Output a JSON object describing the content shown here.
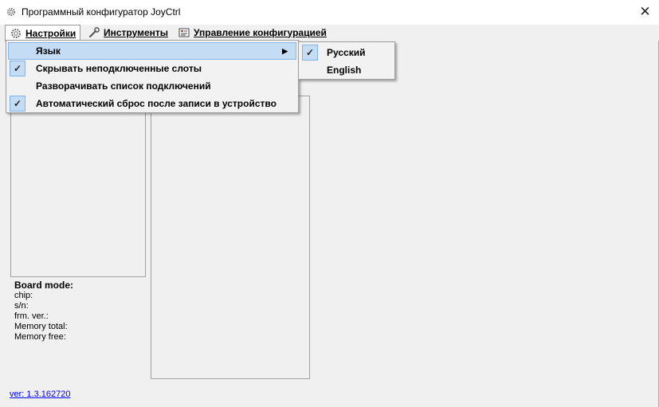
{
  "window": {
    "title": "Программный конфигуратор JoyCtrl",
    "close_glyph": "✕"
  },
  "menubar": {
    "items": [
      {
        "label": "Настройки",
        "icon": "gear-icon"
      },
      {
        "label": "Инструменты",
        "icon": "wrench-icon"
      },
      {
        "label": "Управление конфигурацией",
        "icon": "config-icon"
      }
    ]
  },
  "settings_menu": {
    "items": [
      {
        "label": "Язык",
        "checked": false,
        "has_submenu": true
      },
      {
        "label": "Скрывать неподключенные слоты",
        "checked": true
      },
      {
        "label": "Разворачивать список подключений",
        "checked": false
      },
      {
        "label": "Автоматический сброс после записи в устройство",
        "checked": true
      }
    ],
    "submenu_arrow": "▶"
  },
  "language_submenu": {
    "items": [
      {
        "label": "Русский",
        "checked": true
      },
      {
        "label": "English",
        "checked": false
      }
    ]
  },
  "check_glyph": "✓",
  "board_info": {
    "header": "Board mode:",
    "chip": "chip:",
    "sn": "s/n:",
    "firmware": "frm. ver.:",
    "memory_total": "Memory total:",
    "memory_free": "Memory free:"
  },
  "version": "ver: 1.3.162720",
  "colors": {
    "highlight": "#c5dcf5",
    "highlight_border": "#8cb6e6",
    "link": "#0000ee"
  }
}
